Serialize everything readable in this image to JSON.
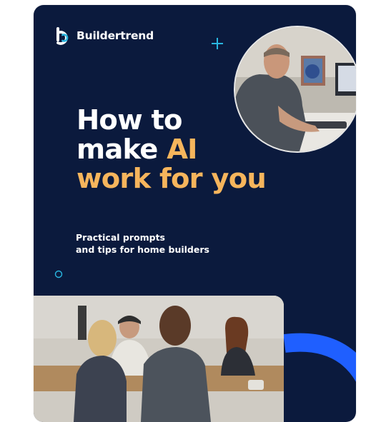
{
  "brand": {
    "name": "Buildertrend",
    "logo_icon": "buildertrend-b-logo-icon"
  },
  "headline": {
    "line1": "How to",
    "line2_plain": "make ",
    "line2_accent": "AI",
    "line3_accent": "work for you"
  },
  "subhead": {
    "line1": "Practical prompts",
    "line2": "and tips for home builders"
  },
  "colors": {
    "card_bg": "#0b1a3d",
    "accent_orange": "#f6b55c",
    "accent_cyan": "#29b6e0",
    "accent_blue": "#1f5fff",
    "text": "#ffffff"
  },
  "decorations": [
    "plus-icon",
    "ring-icon",
    "arc-shape"
  ],
  "images": [
    "man-at-computer-photo",
    "team-meeting-photo"
  ]
}
